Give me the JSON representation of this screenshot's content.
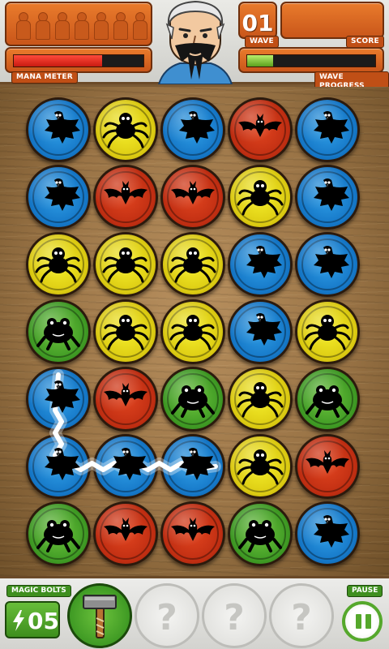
{
  "hud": {
    "mana_label": "MANA METER",
    "mana_fraction": 0.68,
    "wave_label": "WAVE",
    "wave_number": "01",
    "score_label": "SCORE",
    "score_value": "",
    "wave_progress_label": "WAVE PROGRESS",
    "wave_progress_fraction": 0.2,
    "lives_tokens": 7,
    "wizard_icon": "wizard-portrait-icon"
  },
  "board": {
    "rows": 7,
    "cols": 5,
    "grid": [
      [
        "blue",
        "yellow",
        "blue",
        "red",
        "blue"
      ],
      [
        "blue",
        "red",
        "red",
        "yellow",
        "blue"
      ],
      [
        "yellow",
        "yellow",
        "yellow",
        "blue",
        "blue"
      ],
      [
        "green",
        "yellow",
        "yellow",
        "blue",
        "yellow"
      ],
      [
        "blue",
        "red",
        "green",
        "yellow",
        "green"
      ],
      [
        "blue",
        "blue",
        "blue",
        "yellow",
        "red"
      ],
      [
        "green",
        "red",
        "red",
        "green",
        "blue"
      ]
    ],
    "creatures": {
      "blue": "crow",
      "yellow": "spider",
      "red": "bat",
      "green": "frog"
    },
    "colors": {
      "blue": "#1a80cf",
      "yellow": "#e2d21a",
      "red": "#c8361a",
      "green": "#45a12a"
    },
    "selected_path": [
      [
        4,
        0
      ],
      [
        5,
        0
      ],
      [
        5,
        1
      ],
      [
        5,
        2
      ]
    ]
  },
  "footer": {
    "magic_bolts_label": "MAGIC BOLTS",
    "magic_bolts_count": "05",
    "pause_label": "PAUSE",
    "powerups": [
      "hammer",
      "locked",
      "locked",
      "locked"
    ],
    "locked_symbol": "?"
  }
}
